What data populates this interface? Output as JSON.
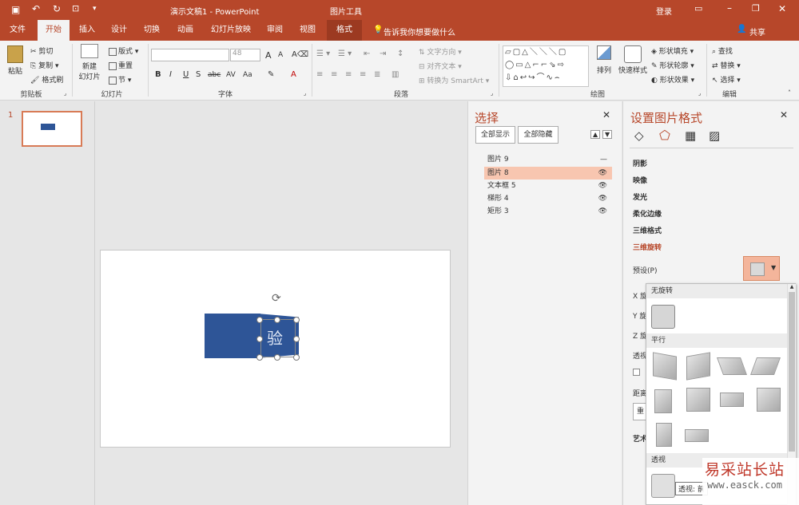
{
  "titlebar": {
    "doc_title": "演示文稿1 - PowerPoint",
    "context_tool": "图片工具",
    "login": "登录"
  },
  "tabs": [
    "文件",
    "开始",
    "插入",
    "设计",
    "切换",
    "动画",
    "幻灯片放映",
    "审阅",
    "视图",
    "格式"
  ],
  "tellme": "告诉我你想要做什么",
  "share": "共享",
  "ribbon": {
    "clipboard": {
      "paste": "粘贴",
      "cut": "剪切",
      "copy": "复制",
      "format_painter": "格式刷",
      "label": "剪贴板"
    },
    "slides": {
      "new_slide_1": "新建",
      "new_slide_2": "幻灯片",
      "layout": "版式",
      "reset": "重置",
      "section": "节",
      "label": "幻灯片"
    },
    "font": {
      "size": "48",
      "label": "字体",
      "bold": "B",
      "italic": "I",
      "underline": "U",
      "strike": "S",
      "shadow": "abc",
      "spacing": "AV",
      "case": "Aa",
      "color": "A",
      "grow": "A",
      "shrink": "A"
    },
    "paragraph": {
      "text_direction": "文字方向",
      "align_text": "对齐文本",
      "smartart": "转换为 SmartArt",
      "label": "段落"
    },
    "drawing": {
      "arrange": "排列",
      "quick_styles": "快速样式",
      "shape_fill": "形状填充",
      "shape_outline": "形状轮廓",
      "shape_effects": "形状效果",
      "label": "绘图"
    },
    "editing": {
      "find": "查找",
      "replace": "替换",
      "select": "选择",
      "label": "编辑"
    }
  },
  "thumb": {
    "number": "1"
  },
  "slide_text": "验",
  "selection_pane": {
    "title": "选择",
    "show_all": "全部显示",
    "hide_all": "全部隐藏",
    "items": [
      {
        "label": "图片 9",
        "eye": "—"
      },
      {
        "label": "图片 8",
        "eye": "👁"
      },
      {
        "label": "文本框 5",
        "eye": "👁"
      },
      {
        "label": "梯形 4",
        "eye": "👁"
      },
      {
        "label": "矩形 3",
        "eye": "👁"
      }
    ]
  },
  "format_pane": {
    "title": "设置图片格式",
    "sections": [
      "阴影",
      "映像",
      "发光",
      "柔化边缘",
      "三维格式",
      "三维旋转"
    ],
    "preset_label": "预设(P)",
    "partial_labels": [
      "X 旋",
      "Y 旋",
      "Z 旋",
      "透视",
      "距离",
      "重",
      "艺术"
    ]
  },
  "gallery": {
    "no_rotation": "无旋转",
    "parallel": "平行",
    "perspective": "透视",
    "tooltip": "透视: 前"
  },
  "watermark": {
    "cn": "易采站长站",
    "url": "www.easck.com"
  },
  "colors": {
    "accent": "#b7472a",
    "shape_blue": "#2e5597",
    "selected_row": "#f8c6b0"
  }
}
